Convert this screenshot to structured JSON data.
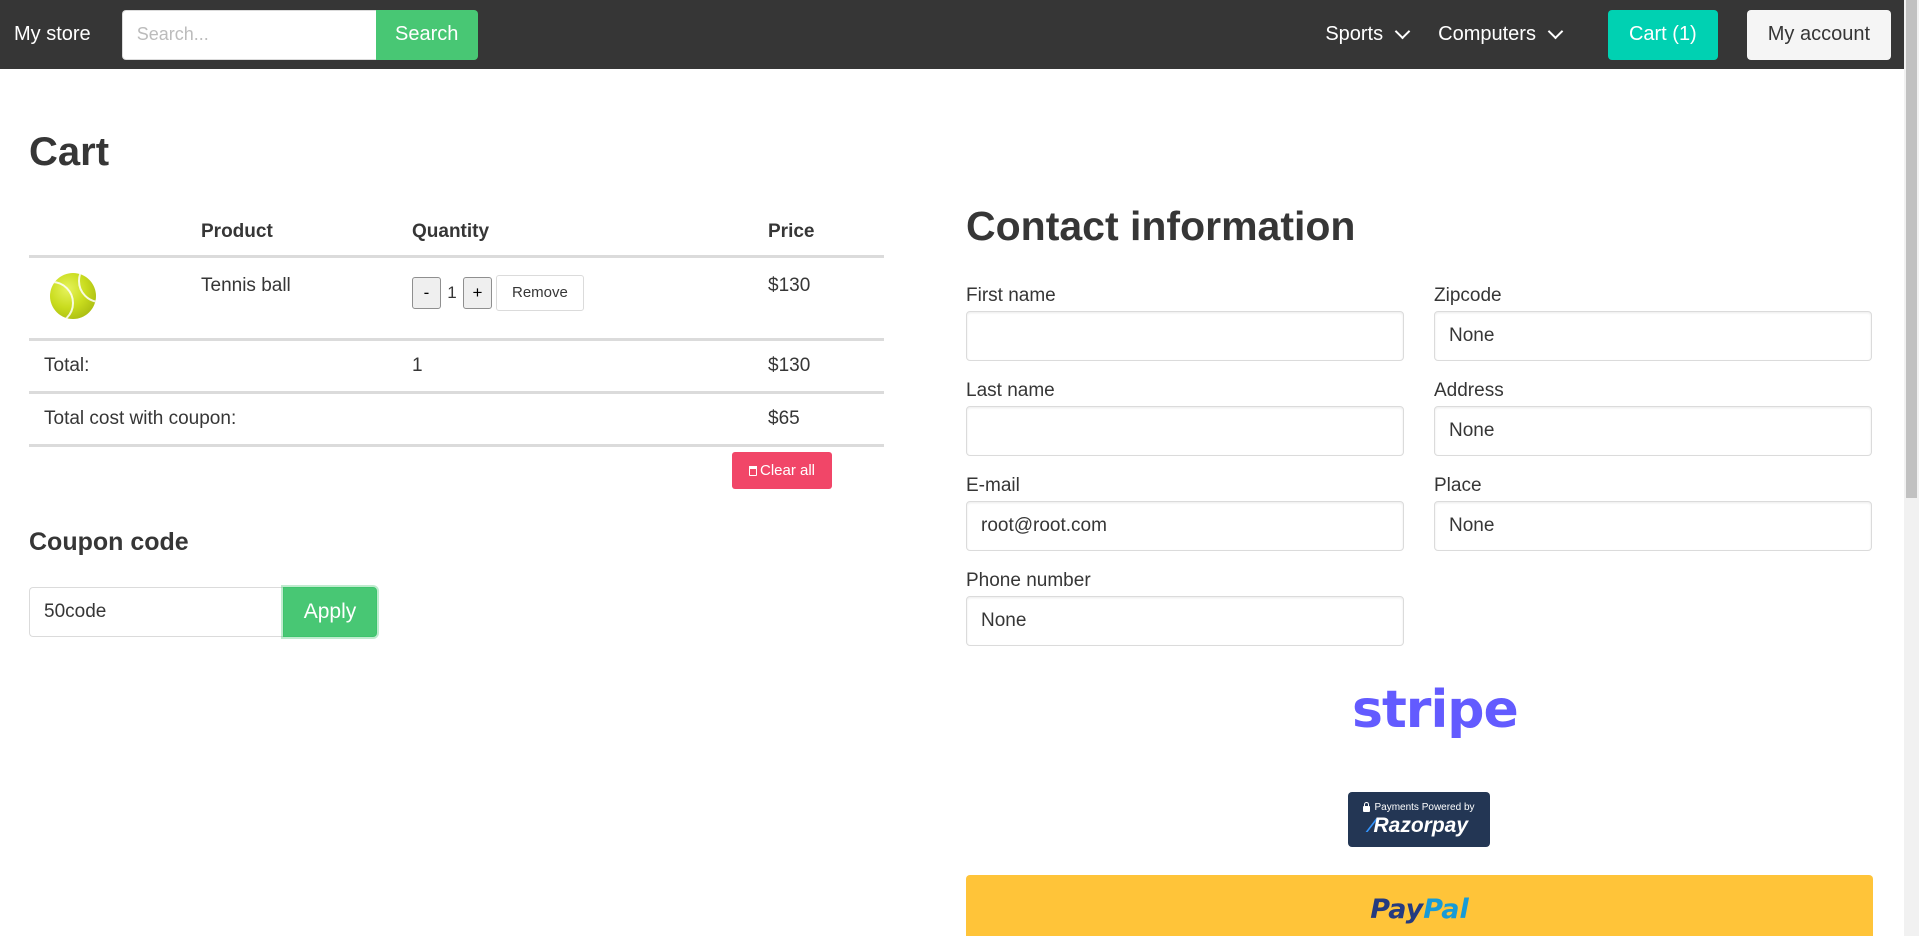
{
  "navbar": {
    "brand": "My store",
    "search_placeholder": "Search...",
    "search_button": "Search",
    "menu": [
      {
        "label": "Sports",
        "icon": "chevron-down-icon"
      },
      {
        "label": "Computers",
        "icon": "chevron-down-icon"
      }
    ],
    "cart_button": "Cart (1)",
    "account_button": "My account"
  },
  "cart": {
    "title": "Cart",
    "columns": [
      "",
      "Product",
      "Quantity",
      "Price"
    ],
    "items": [
      {
        "image_icon": "tennis-ball-icon",
        "product": "Tennis ball",
        "quantity": "1",
        "price": "$130",
        "minus": "-",
        "plus": "+",
        "remove": "Remove"
      }
    ],
    "total_label": "Total:",
    "total_quantity": "1",
    "total_price": "$130",
    "coupon_total_label": "Total cost with coupon:",
    "coupon_total_price": "$65",
    "clear_all": "Clear all"
  },
  "coupon": {
    "title": "Coupon code",
    "value": "50code",
    "apply_button": "Apply"
  },
  "contact": {
    "title": "Contact information",
    "fields": {
      "first_name": {
        "label": "First name",
        "value": ""
      },
      "last_name": {
        "label": "Last name",
        "value": ""
      },
      "email": {
        "label": "E-mail",
        "value": "root@root.com"
      },
      "phone": {
        "label": "Phone number",
        "value": "None"
      },
      "zipcode": {
        "label": "Zipcode",
        "value": "None"
      },
      "address": {
        "label": "Address",
        "value": "None"
      },
      "place": {
        "label": "Place",
        "value": "None"
      }
    }
  },
  "payments": {
    "stripe": "stripe",
    "razorpay_caption": "Payments Powered by",
    "razorpay_name": "Razorpay",
    "paypal_part1": "Pay",
    "paypal_part2": "Pal"
  },
  "colors": {
    "navbar": "#363636",
    "success": "#48c774",
    "primary": "#00d1b2",
    "danger": "#f14668",
    "stripe": "#635bff",
    "razorpay": "#233654",
    "paypal": "#ffc439"
  }
}
